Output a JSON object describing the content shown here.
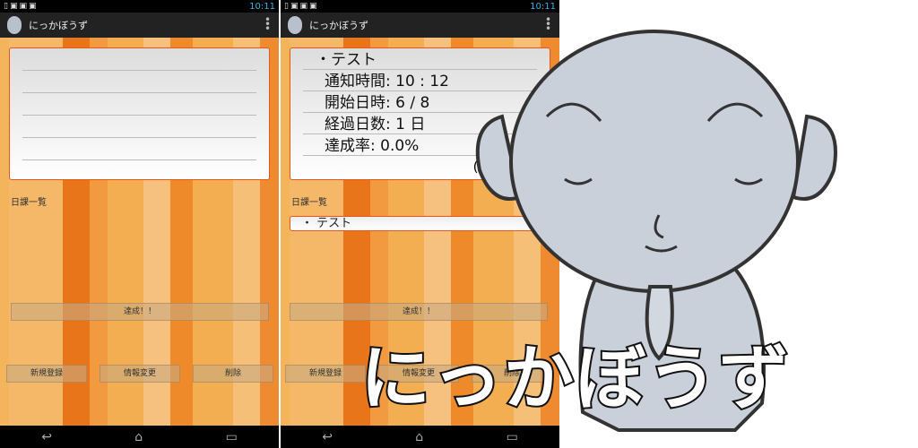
{
  "status": {
    "time": "10:11"
  },
  "app": {
    "title": "にっかぼうず"
  },
  "phone1": {
    "list_label": "日課一覧",
    "achieve_button": "達成！！",
    "buttons": [
      "新規登録",
      "情報変更",
      "削除"
    ]
  },
  "phone2": {
    "task_name": "・テスト",
    "rows": [
      "通知時間:  10 : 12",
      "開始日時:   6 / 8",
      "経過日数:  1 日",
      "達成率:    0.0%"
    ],
    "ratio": "( 0/1 )",
    "list_label": "日課一覧",
    "list_items": [
      "・ テスト"
    ],
    "achieve_button": "達成！！",
    "buttons": [
      "新規登録",
      "情報変更",
      "削除"
    ]
  },
  "nav": {
    "back": "↩",
    "home": "⌂",
    "recent": "▭"
  },
  "promo": {
    "title": "にっかぼうず"
  }
}
